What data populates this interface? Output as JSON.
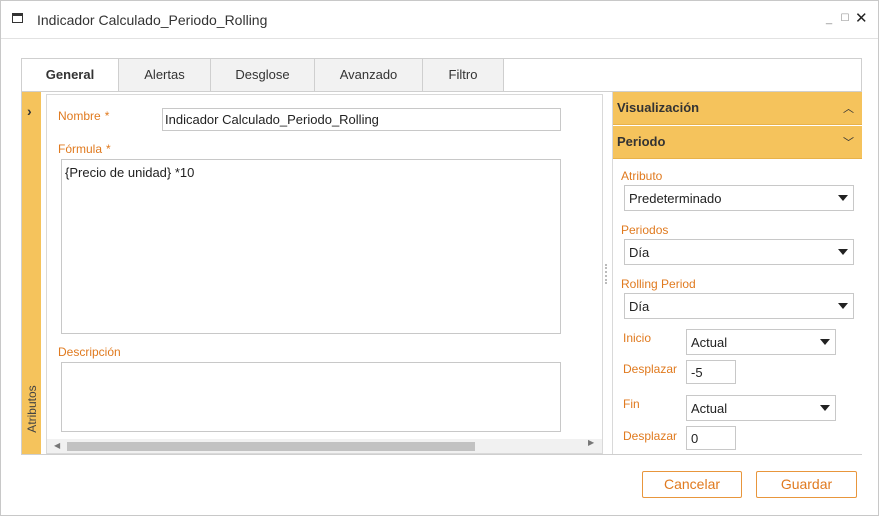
{
  "window": {
    "title": "Indicador Calculado_Periodo_Rolling",
    "app_icon": "window-icon",
    "controls": {
      "minimize": "minimize-icon",
      "maximize": "maximize-icon",
      "close": "close-icon"
    }
  },
  "tabs": [
    {
      "label": "General",
      "active": true
    },
    {
      "label": "Alertas",
      "active": false
    },
    {
      "label": "Desglose",
      "active": false
    },
    {
      "label": "Avanzado",
      "active": false
    },
    {
      "label": "Filtro",
      "active": false
    }
  ],
  "attributes_panel": {
    "label": "Atributos",
    "toggle_icon": "chevron-right-icon"
  },
  "form": {
    "name_label": "Nombre",
    "name_value": "Indicador Calculado_Periodo_Rolling",
    "formula_label": "Fórmula",
    "formula_value": "{Precio de unidad} *10",
    "description_label": "Descripción",
    "description_value": "",
    "required_mark": "*"
  },
  "right_panel": {
    "visualizacion": {
      "title": "Visualización",
      "icon": "chevron-up-icon"
    },
    "periodo": {
      "title": "Periodo",
      "icon": "chevron-down-icon",
      "atributo": {
        "label": "Atributo",
        "value": "Predeterminado"
      },
      "periodos": {
        "label": "Periodos",
        "value": "Día"
      },
      "rolling_period": {
        "label": "Rolling Period",
        "value": "Día"
      },
      "inicio": {
        "label": "Inicio",
        "value": "Actual"
      },
      "inicio_desplazar": {
        "label": "Desplazar",
        "value": "-5"
      },
      "fin": {
        "label": "Fin",
        "value": "Actual"
      },
      "fin_desplazar": {
        "label": "Desplazar",
        "value": "0"
      }
    }
  },
  "buttons": {
    "cancel": "Cancelar",
    "save": "Guardar"
  },
  "colors": {
    "accent": "#f5c35c",
    "label_orange": "#e07a1f",
    "button_border": "#e8963c"
  }
}
